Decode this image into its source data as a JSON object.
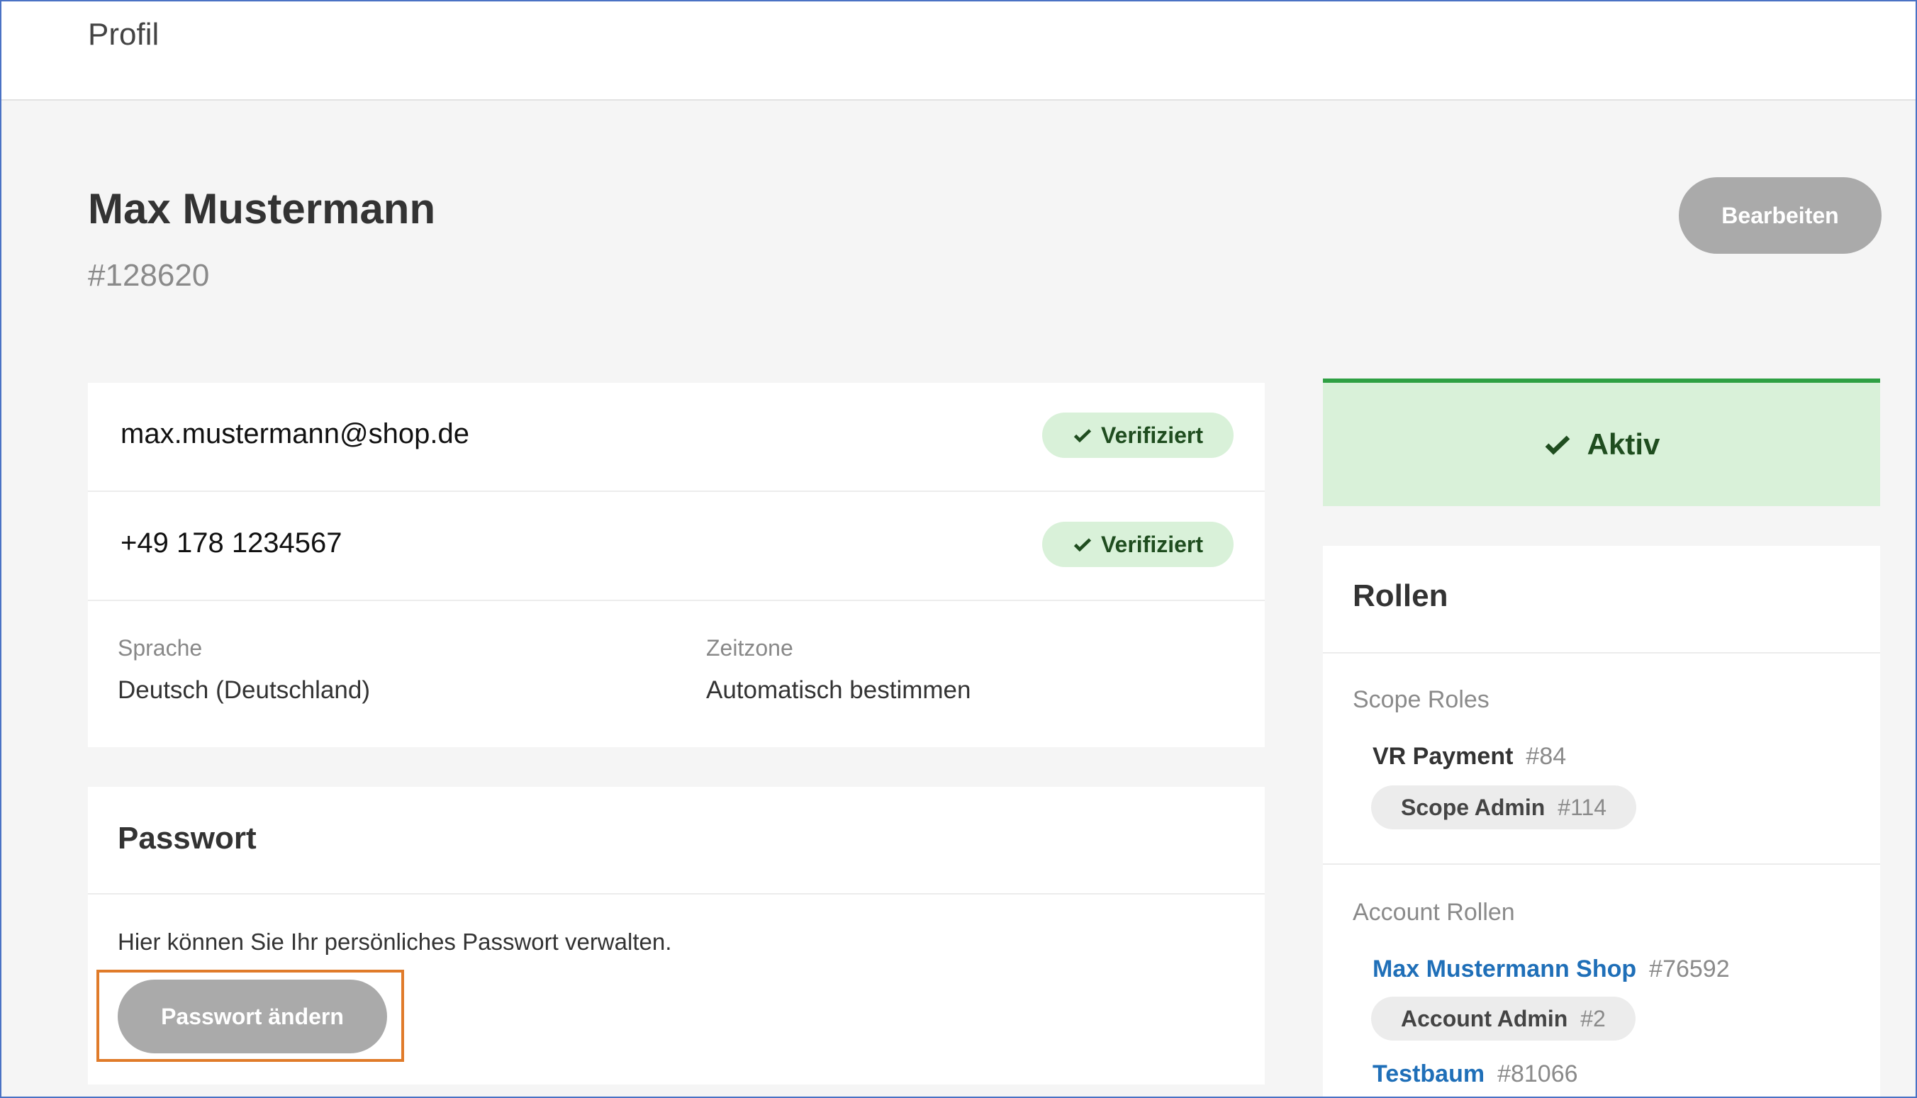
{
  "topbar": {
    "title": "Profil"
  },
  "profile": {
    "name": "Max Mustermann",
    "id": "#128620",
    "edit_label": "Bearbeiten"
  },
  "contact": {
    "email": "max.mustermann@shop.de",
    "email_status": "Verifiziert",
    "phone": "+49 178 1234567",
    "phone_status": "Verifiziert"
  },
  "settings": {
    "language_label": "Sprache",
    "language_value": "Deutsch (Deutschland)",
    "timezone_label": "Zeitzone",
    "timezone_value": "Automatisch bestimmen"
  },
  "password": {
    "title": "Passwort",
    "description": "Hier können Sie Ihr persönliches Passwort verwalten.",
    "button_label": "Passwort ändern"
  },
  "status": {
    "label": "Aktiv"
  },
  "roles": {
    "title": "Rollen",
    "scope_label": "Scope Roles",
    "scope": [
      {
        "name": "VR Payment",
        "id": "#84",
        "role": "Scope Admin",
        "role_id": "#114"
      }
    ],
    "account_label": "Account Rollen",
    "accounts": [
      {
        "name": "Max Mustermann Shop",
        "id": "#76592",
        "role": "Account Admin",
        "role_id": "#2"
      },
      {
        "name": "Testbaum",
        "id": "#81066"
      }
    ]
  },
  "colors": {
    "highlight": "#e07b2a",
    "verified_bg": "#d9f1d9",
    "active_border": "#2ea043",
    "link": "#1f6fb8",
    "button_disabled": "#aaaaaa"
  }
}
